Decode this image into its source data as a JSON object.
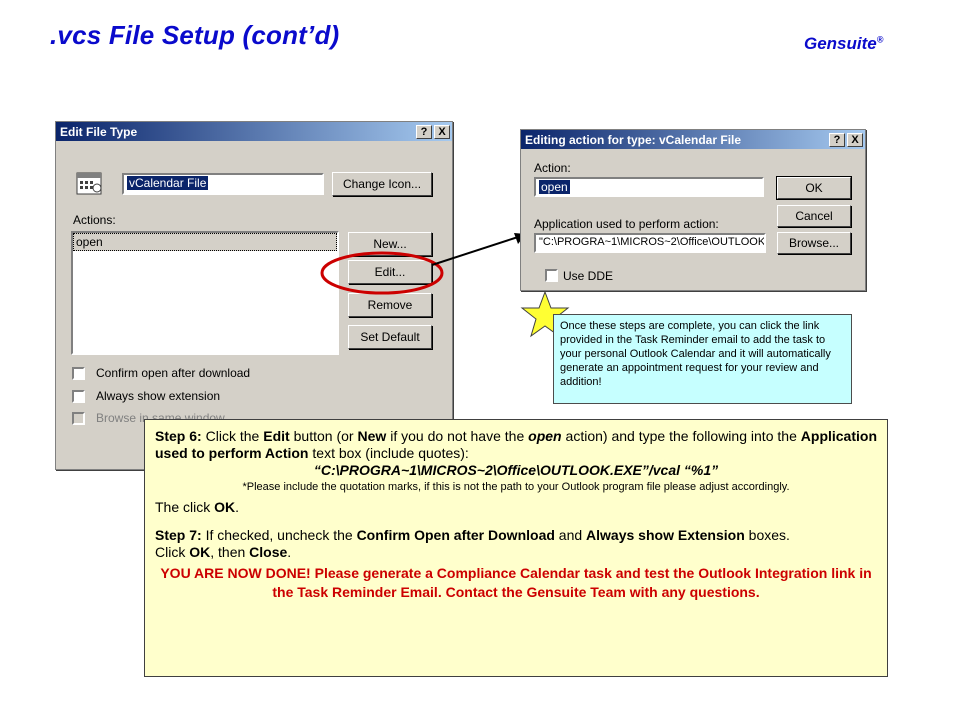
{
  "slide": {
    "title": ".vcs File Setup (cont’d)",
    "brand": "Gensuite",
    "brand_mark": "®"
  },
  "edit_file_type": {
    "title": "Edit File Type",
    "help_btn": "?",
    "close_btn": "X",
    "type_name": "vCalendar File",
    "change_icon_label": "Change Icon...",
    "actions_label": "Actions:",
    "actions": [
      "open"
    ],
    "new_label": "New...",
    "edit_label": "Edit...",
    "remove_label": "Remove",
    "set_default_label": "Set Default",
    "confirm_open_label": "Confirm open after download",
    "always_show_label": "Always show extension",
    "browse_same_label": "Browse in same window"
  },
  "editing_action": {
    "title": "Editing action for type: vCalendar File",
    "help_btn": "?",
    "close_btn": "X",
    "action_label": "Action:",
    "action_value": "open",
    "app_label": "Application used to perform action:",
    "app_value": "\"C:\\PROGRA~1\\MICROS~2\\Office\\OUTLOOK.",
    "use_dde_label": "Use DDE",
    "ok_label": "OK",
    "cancel_label": "Cancel",
    "browse_label": "Browse..."
  },
  "note": {
    "text": "Once these steps are complete, you can click the link provided in the Task Reminder email to add the task to your personal Outlook Calendar and it will automatically generate an appointment request for your review and addition!"
  },
  "instructions": {
    "step6_label": "Step 6:",
    "step6_a": " Click the ",
    "step6_edit": "Edit",
    "step6_b": " button (or ",
    "step6_new": "New",
    "step6_c": " if you do not have the ",
    "step6_open": "open",
    "step6_d": " action) and type the following into the ",
    "step6_app": "Application used to perform Action",
    "step6_e": " text box (include quotes):",
    "path": "“C:\\PROGRA~1\\MICROS~2\\Office\\OUTLOOK.EXE”/vcal “%1”",
    "quote_note": "*Please include the quotation marks, if this is not the path to your Outlook program file please adjust accordingly.",
    "then_a": "The click ",
    "then_ok": "OK",
    "then_b": ".",
    "step7_label": "Step 7:",
    "step7_a": " If checked, uncheck the ",
    "step7_confirm": "Confirm Open after Download",
    "step7_b": " and ",
    "step7_always": "Always show Extension",
    "step7_c": " boxes.",
    "click_a": "Click ",
    "click_ok": "OK",
    "click_b": ", then ",
    "click_close": "Close",
    "click_c": ".",
    "done": "YOU ARE NOW DONE!  Please generate a Compliance Calendar task and test the Outlook Integration link in the Task Reminder Email.  Contact the Gensuite Team with any questions."
  },
  "colors": {
    "title": "#0a0acc",
    "highlight_circle": "#cc0000",
    "note_bg": "#c6ffff",
    "panel_bg": "#ffffcc",
    "star": "#ffff33"
  }
}
